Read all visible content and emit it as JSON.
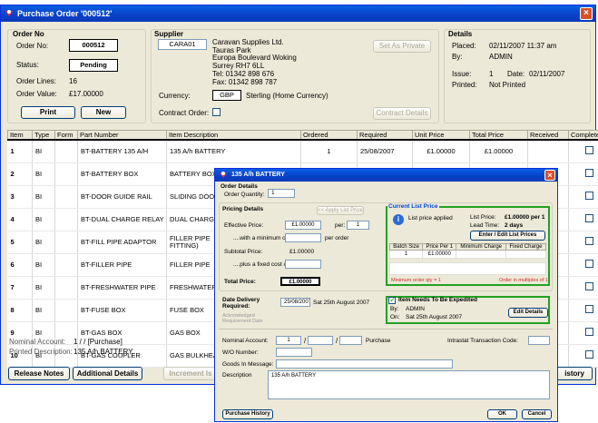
{
  "main_window": {
    "title": "Purchase Order '000512'",
    "order_no": {
      "heading": "Order No",
      "order_no_label": "Order No:",
      "order_no_value": "000512",
      "status_label": "Status:",
      "status_value": "Pending",
      "lines_label": "Order Lines:",
      "lines_value": "16",
      "value_label": "Order Value:",
      "value_value": "£17.00000",
      "print_btn": "Print",
      "new_btn": "New"
    },
    "supplier": {
      "heading": "Supplier",
      "code": "CARA01",
      "address": [
        "Caravan Supplies Ltd.",
        "Tauras Park",
        "Europa Boulevard Woking",
        "Surrey RH7 6LL",
        "Tel: 01342 898 676",
        "Fax: 01342 898 787"
      ],
      "set_private_btn": "Set As Private",
      "currency_label": "Currency:",
      "currency_code": "GBP",
      "currency_name": "Sterling  (Home Currency)",
      "contract_label": "Contract Order:",
      "contract_details_btn": "Contract Details"
    },
    "details": {
      "heading": "Details",
      "placed_label": "Placed:",
      "placed_value": "02/11/2007  11:37 am",
      "by_label": "By:",
      "by_value": "ADMIN",
      "issue_label": "Issue:",
      "issue_value": "1",
      "date_label": "Date:",
      "date_value": "02/11/2007",
      "printed_label": "Printed:",
      "printed_value": "Not Printed"
    },
    "grid": {
      "columns": [
        "Item",
        "Type",
        "Form",
        "Part Number",
        "Item Description",
        "Ordered",
        "Required",
        "Unit Price",
        "Total Price",
        "Received",
        "Complete"
      ],
      "rows": [
        {
          "item": "1",
          "type": "BI",
          "form": "",
          "part": "BT-BATTERY 135 A/H",
          "desc": "135 A/h BATTERY",
          "ordered": "1",
          "required": "25/08/2007",
          "unit": "£1.00000",
          "total": "£1.00000",
          "received": ""
        },
        {
          "item": "2",
          "type": "BI",
          "form": "",
          "part": "BT-BATTERY BOX",
          "desc": "BATTERY BOX",
          "ordered": "1",
          "required": "25/08/2007",
          "unit": "£1.00000",
          "total": "£1.00000",
          "received": ""
        },
        {
          "item": "3",
          "type": "BI",
          "form": "",
          "part": "BT-DOOR GUIDE RAIL",
          "desc": "SLIDING DOO",
          "ordered": "",
          "required": "",
          "unit": "",
          "total": "",
          "received": ""
        },
        {
          "item": "4",
          "type": "BI",
          "form": "",
          "part": "BT-DUAL CHARGE RELAY",
          "desc": "DUAL CHARGE",
          "ordered": "",
          "required": "",
          "unit": "",
          "total": "",
          "received": ""
        },
        {
          "item": "5",
          "type": "BI",
          "form": "",
          "part": "BT-FILL PIPE ADAPTOR",
          "desc": "FILLER PIPE\nFITTING)",
          "ordered": "",
          "required": "",
          "unit": "",
          "total": "",
          "received": ""
        },
        {
          "item": "6",
          "type": "BI",
          "form": "",
          "part": "BT-FILLER PIPE",
          "desc": "FILLER PIPE",
          "ordered": "",
          "required": "",
          "unit": "",
          "total": "",
          "received": ""
        },
        {
          "item": "7",
          "type": "BI",
          "form": "",
          "part": "BT-FRESHWATER PIPE",
          "desc": "FRESHWATER",
          "ordered": "",
          "required": "",
          "unit": "",
          "total": "",
          "received": ""
        },
        {
          "item": "8",
          "type": "BI",
          "form": "",
          "part": "BT-FUSE BOX",
          "desc": "FUSE BOX",
          "ordered": "",
          "required": "",
          "unit": "",
          "total": "",
          "received": ""
        },
        {
          "item": "9",
          "type": "BI",
          "form": "",
          "part": "BT-GAS BOX",
          "desc": "GAS BOX",
          "ordered": "",
          "required": "",
          "unit": "",
          "total": "",
          "received": ""
        },
        {
          "item": "10",
          "type": "BI",
          "form": "",
          "part": "BT-GAS COUPLER",
          "desc": "GAS BULKHEA",
          "ordered": "",
          "required": "",
          "unit": "",
          "total": "",
          "received": ""
        }
      ]
    },
    "footer": {
      "nominal_label": "Nominal Account:",
      "nominal_value": "1  /  /   [Purchase]",
      "printed_desc_label": "Printed Description:",
      "printed_desc_value": "135 A/h BATTERY",
      "release_btn": "Release Notes",
      "additional_btn": "Additional Details",
      "increment_btn": "Increment Is",
      "history_btn": "istory"
    }
  },
  "dialog": {
    "title": "135 A/h BATTERY",
    "order_details_heading": "Order Details",
    "qty_label": "Order Quantity:",
    "qty_value": "1",
    "pricing_heading": "Pricing Details",
    "apply_list_btn": "<< Apply List Price",
    "effective_label": "Effective Price:",
    "effective_value": "£1.00000",
    "per_label": "per:",
    "per_value": "1",
    "min_label": "....with a minimum of:",
    "per_order": "per order",
    "subtotal_label": "Subtotal Price:",
    "subtotal_value": "£1.00000",
    "fixed_label": "....plus a fixed cost of:",
    "total_label": "Total Price:",
    "total_value": "£1.00000",
    "current_list_heading": "Current List Price",
    "list_applied": "List price applied",
    "list_price_label": "List Price:",
    "list_price_value": "£1.00000 per 1",
    "lead_label": "Lead Time:",
    "lead_value": "2 days",
    "enter_edit_btn": "Enter / Edit List Prices",
    "batch_columns": [
      "Batch Size",
      "Price Per 1",
      "Minimum Charge",
      "Fixed Charge"
    ],
    "batch_rows": [
      [
        "1",
        "£1.00000",
        "",
        ""
      ]
    ],
    "min_qty_note": "Minimum order qty = 1",
    "multiples_note": "Order in multiples of 1",
    "delivery_label": "Date Delivery Required:",
    "delivery_value": "25/08/2007",
    "delivery_long": "Sat 25th August 2007",
    "ack_label": "Acknowledged Requirement Date",
    "expedite_label": "Item Needs To Be Expedited",
    "exp_by_label": "By:",
    "exp_by_value": "ADMIN",
    "exp_on_label": "On:",
    "exp_on_value": "Sat 25th August 2007",
    "edit_details_btn": "Edit Details",
    "nominal_label": "Nominal Account:",
    "nominal_1": "1",
    "nominal_tag": "Purchase",
    "intrastat_label": "Intrastat Transaction Code:",
    "wo_label": "W/O Number:",
    "goods_in_label": "Goods In Message:",
    "desc_label": "Description",
    "desc_value": "135 A/h BATTERY",
    "history_btn": "Purchase History",
    "ok_btn": "OK",
    "cancel_btn": "Cancel"
  }
}
